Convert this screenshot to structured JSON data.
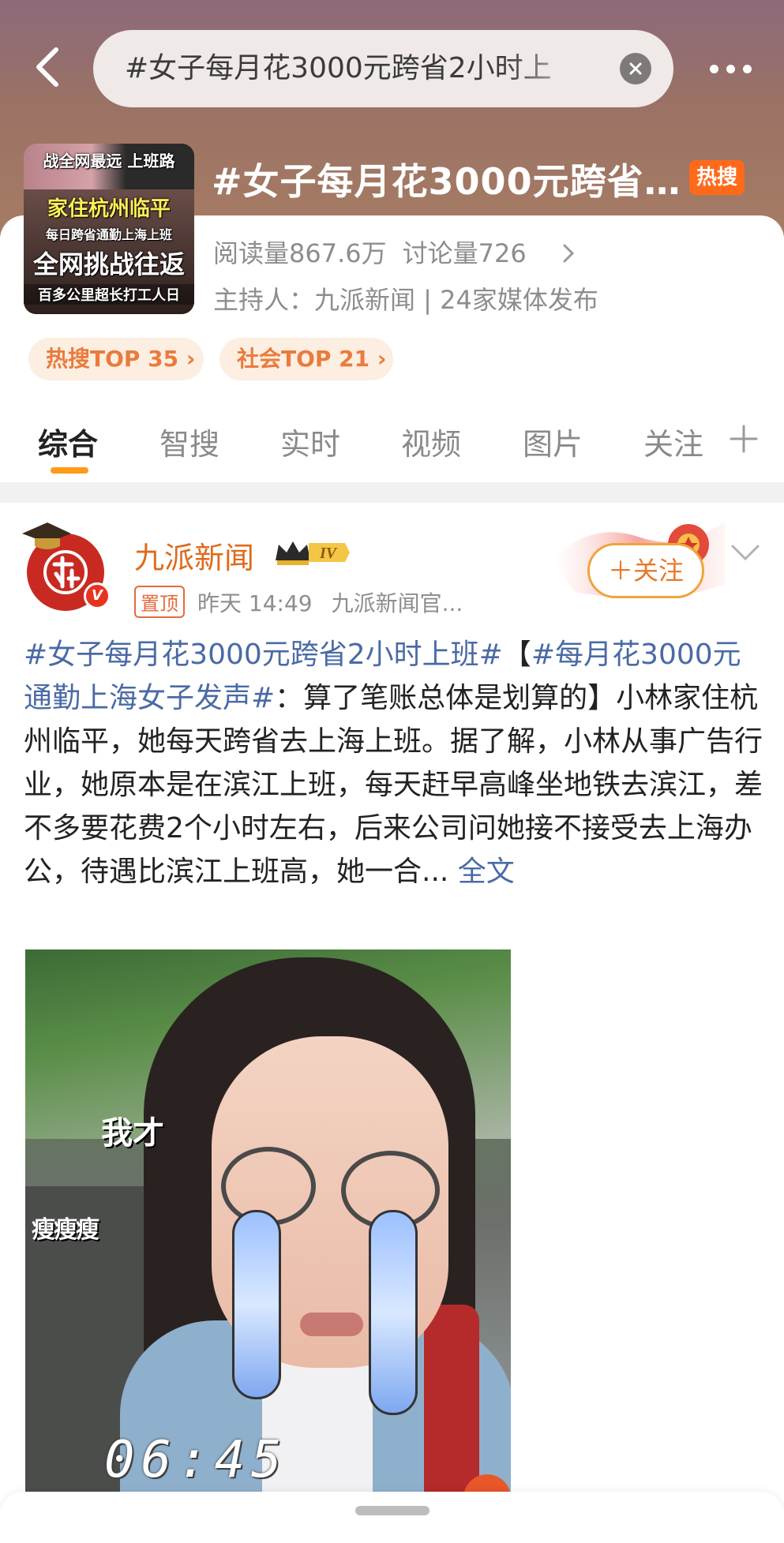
{
  "header": {
    "search_query": "#女子每月花3000元跨省2小时上",
    "topic_title": "#女子每月花3000元跨省…",
    "hot_badge": "热搜",
    "reads": "阅读量867.6万",
    "discussions": "讨论量726",
    "host": "主持人：九派新闻 | 24家媒体发布",
    "thumb_lines": [
      "战全网最远 上班路",
      "家住杭州临平",
      "每日跨省通勤上海上班",
      "全网挑战往返",
      "百多公里超长打工人日"
    ],
    "rank_tags": [
      "热搜TOP 35 ›",
      "社会TOP 21 ›"
    ]
  },
  "tabs": [
    "综合",
    "智搜",
    "实时",
    "视频",
    "图片",
    "关注"
  ],
  "post": {
    "author": "九派新闻",
    "level_badge": "IV",
    "pin": "置顶",
    "time": "昨天 14:49",
    "source": "九派新闻官...",
    "follow_label": "＋关注",
    "hashtag1": "#女子每月花3000元跨省2小时上班#",
    "bracket_open": "【",
    "hashtag2": "#每月花3000元通勤上海女子发声#",
    "body_text": "：算了笔账总体是划算的】小林家住杭州临平，她每天跨省去上海上班。据了解，小林从事广告行业，她原本是在滨江上班，每天赶早高峰坐地铁去滨江，差不多要花费2个小时左右，后来公司问她接不接受去上海办公，待遇比滨江上班高，她一合...",
    "fulltext_link": "全文"
  },
  "video": {
    "caption": "06:45",
    "side_text": "我才",
    "side_text2": "瘦瘦瘦"
  },
  "colors": {
    "accent_orange": "#ff9a1a",
    "hashtag_blue": "#4a6aa5",
    "author_orange": "#e06a1c",
    "hot_red": "#ff6a1a"
  },
  "icons": [
    "back-icon",
    "clear-icon",
    "more-icon",
    "chevron-right-icon",
    "plus-icon",
    "graduation-cap-icon",
    "verified-v-icon",
    "crown-icon",
    "chevron-down-icon"
  ]
}
